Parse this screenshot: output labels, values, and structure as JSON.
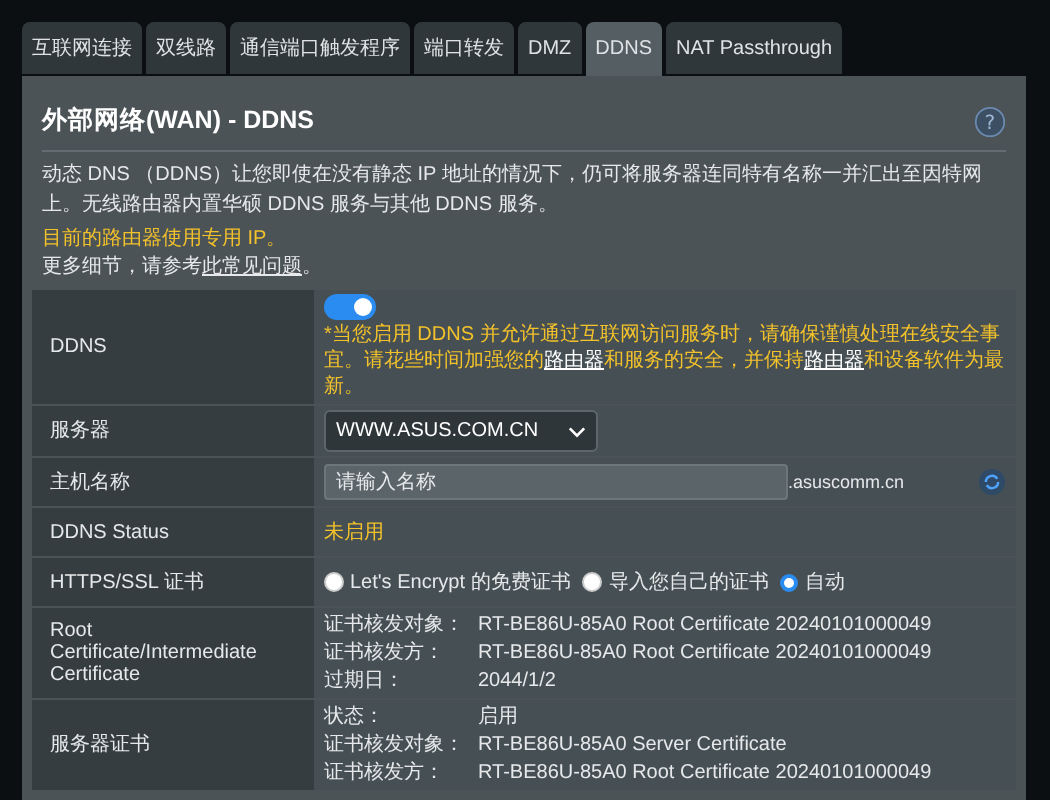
{
  "tabs": [
    {
      "label": "互联网连接",
      "selected": false
    },
    {
      "label": "双线路",
      "selected": false
    },
    {
      "label": "通信端口触发程序",
      "selected": false
    },
    {
      "label": "端口转发",
      "selected": false
    },
    {
      "label": "DMZ",
      "selected": false
    },
    {
      "label": "DDNS",
      "selected": true
    },
    {
      "label": "NAT Passthrough",
      "selected": false
    }
  ],
  "title": "外部网络(WAN) - DDNS",
  "help": "?",
  "description": "动态 DNS （DDNS）让您即使在没有静态 IP 地址的情况下，仍可将服务器连同特有名称一并汇出至因特网上。无线路由器内置华硕 DDNS 服务与其他 DDNS 服务。",
  "notice": "目前的路由器使用专用 IP。",
  "more_info": {
    "text": "更多细节，请参考",
    "link": "此常见问题",
    "end": "。"
  },
  "rows": [
    {
      "kind": "toggle",
      "label": "DDNS",
      "on": true,
      "warning": [
        {
          "kind": "plain",
          "text": "*当您启用 DDNS 并允许通过互联网访问服务时，请确保谨慎处理在线安全事宜。请花些时间加强您的"
        },
        {
          "kind": "link",
          "text": "路由器"
        },
        {
          "kind": "plain",
          "text": "和服务的安全，并保持"
        },
        {
          "kind": "link",
          "text": "路由器"
        },
        {
          "kind": "plain",
          "text": "和设备软件为最新。"
        }
      ]
    },
    {
      "kind": "select",
      "label": "服务器",
      "value": "WWW.ASUS.COM.CN"
    },
    {
      "kind": "input",
      "label": "主机名称",
      "placeholder": "请输入名称",
      "suffix": ".asuscomm.cn"
    },
    {
      "kind": "status",
      "label": "DDNS Status",
      "value": "未启用"
    },
    {
      "kind": "radio",
      "label": "HTTPS/SSL 证书",
      "options": [
        {
          "label": "Let's Encrypt 的免费证书",
          "selected": false
        },
        {
          "label": "导入您自己的证书",
          "selected": false
        },
        {
          "label": "自动",
          "selected": true
        }
      ]
    },
    {
      "kind": "cert",
      "label": "Root Certificate/Intermediate Certificate",
      "fields": [
        {
          "label": "证书核发对象：",
          "value": "RT-BE86U-85A0 Root Certificate 20240101000049"
        },
        {
          "label": "证书核发方：",
          "value": "RT-BE86U-85A0 Root Certificate 20240101000049"
        },
        {
          "label": "过期日：",
          "value": "2044/1/2"
        }
      ]
    },
    {
      "kind": "cert",
      "label": "服务器证书",
      "fields": [
        {
          "label": "状态：",
          "value": "启用"
        },
        {
          "label": "证书核发对象：",
          "value": "RT-BE86U-85A0 Server Certificate"
        },
        {
          "label": "证书核发方：",
          "value": "RT-BE86U-85A0 Root Certificate 20240101000049"
        }
      ]
    }
  ]
}
